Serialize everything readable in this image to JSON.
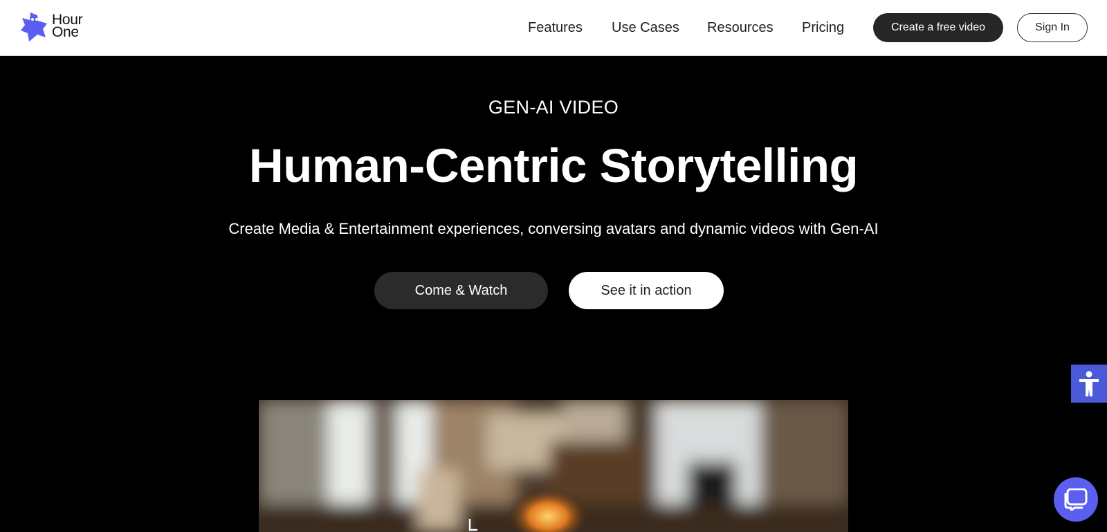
{
  "header": {
    "logo": {
      "line1": "Hour",
      "line2": "One"
    },
    "nav": [
      {
        "label": "Features"
      },
      {
        "label": "Use Cases"
      },
      {
        "label": "Resources"
      },
      {
        "label": "Pricing"
      }
    ],
    "cta_label": "Create a free video",
    "signin_label": "Sign In"
  },
  "hero": {
    "eyebrow": "GEN-AI VIDEO",
    "title": "Human-Centric Storytelling",
    "subtitle": "Create Media & Entertainment experiences, conversing avatars and dynamic videos with Gen-AI",
    "primary_button": "Come & Watch",
    "secondary_button": "See it in action"
  },
  "video": {
    "icon": "blurred-room-scene"
  },
  "widgets": {
    "accessibility_icon": "accessibility-icon",
    "chat_icon": "chat-icon"
  },
  "colors": {
    "brand": "#5b5ff0",
    "dark_button": "#262626",
    "accessibility": "#4a5ad8"
  }
}
